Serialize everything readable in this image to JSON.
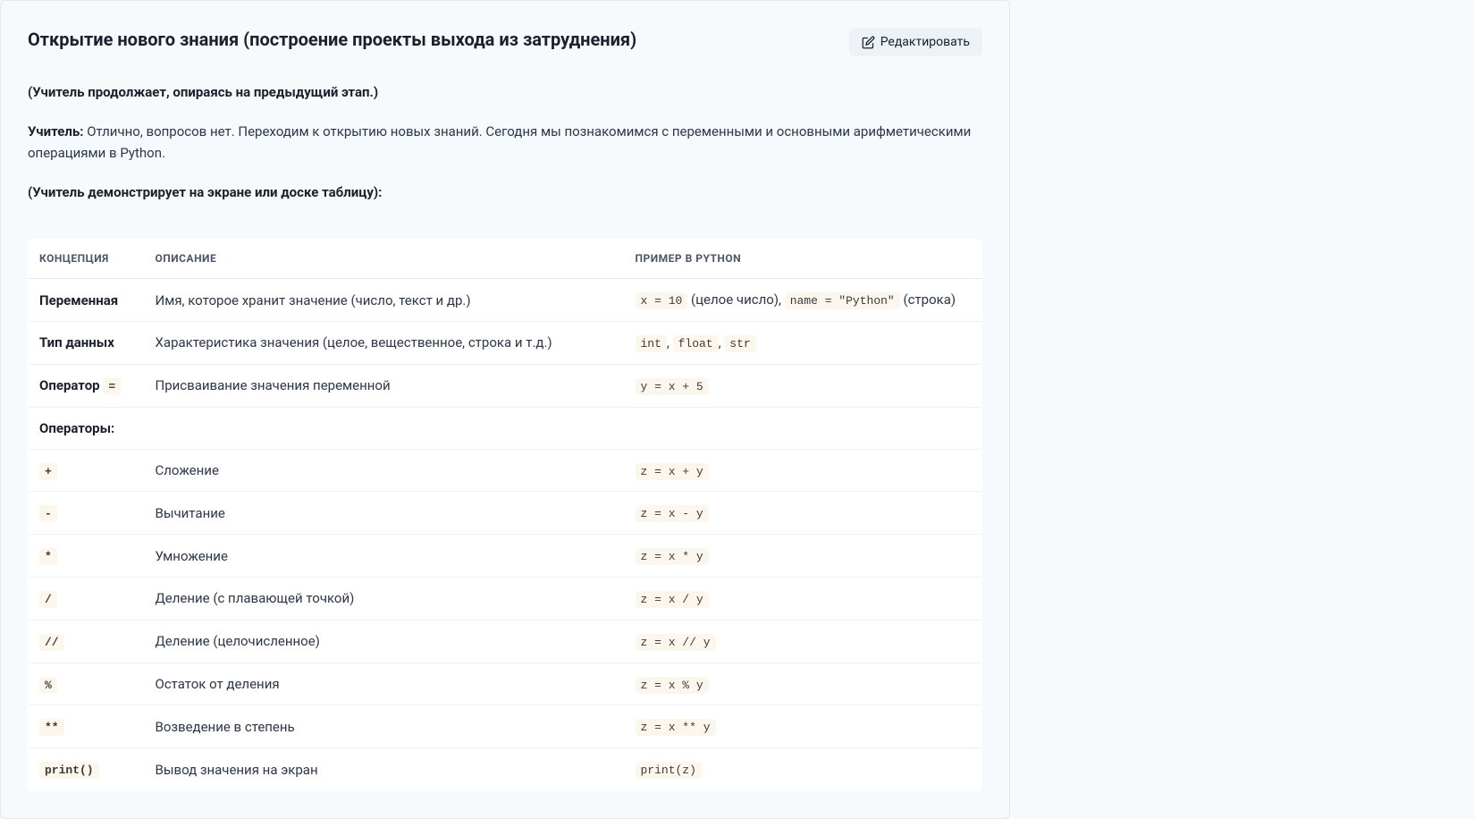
{
  "header": {
    "title": "Открытие нового знания (построение проекты выхода из затруднения)",
    "edit_label": "Редактировать"
  },
  "intro": {
    "line1": "(Учитель продолжает, опираясь на предыдущий этап.)",
    "teacher_label": "Учитель:",
    "teacher_text": " Отлично, вопросов нет. Переходим к открытию новых знаний. Сегодня мы познакомимся с переменными и основными арифметическими операциями в Python.",
    "line3": "(Учитель демонстрирует на экране или доске таблицу):"
  },
  "table": {
    "headers": {
      "concept": "Концепция",
      "description": "Описание",
      "example": "Пример в Python"
    },
    "rows": [
      {
        "concept_bold": "Переменная",
        "concept_code": "",
        "description": "Имя, которое хранит значение (число, текст и др.)",
        "example_parts": [
          {
            "type": "code",
            "v": "x = 10"
          },
          {
            "type": "text",
            "v": " (целое число), "
          },
          {
            "type": "code",
            "v": "name = \"Python\""
          },
          {
            "type": "text",
            "v": " (строка)"
          }
        ]
      },
      {
        "concept_bold": "Тип данных",
        "concept_code": "",
        "description": "Характеристика значения (целое, вещественное, строка и т.д.)",
        "example_parts": [
          {
            "type": "code",
            "v": "int"
          },
          {
            "type": "text",
            "v": ", "
          },
          {
            "type": "code",
            "v": "float"
          },
          {
            "type": "text",
            "v": ", "
          },
          {
            "type": "code",
            "v": "str"
          }
        ]
      },
      {
        "concept_bold": "Оператор ",
        "concept_code": "=",
        "description": "Присваивание значения переменной",
        "example_parts": [
          {
            "type": "code",
            "v": "y = x + 5"
          }
        ]
      },
      {
        "concept_bold": "Операторы:",
        "concept_code": "",
        "description": "",
        "example_parts": []
      },
      {
        "concept_bold": "",
        "concept_code": "+",
        "description": "Сложение",
        "example_parts": [
          {
            "type": "code",
            "v": "z = x + y"
          }
        ]
      },
      {
        "concept_bold": "",
        "concept_code": "-",
        "description": "Вычитание",
        "example_parts": [
          {
            "type": "code",
            "v": "z = x - y"
          }
        ]
      },
      {
        "concept_bold": "",
        "concept_code": "*",
        "description": "Умножение",
        "example_parts": [
          {
            "type": "code",
            "v": "z = x * y"
          }
        ]
      },
      {
        "concept_bold": "",
        "concept_code": "/",
        "description": "Деление (с плавающей точкой)",
        "example_parts": [
          {
            "type": "code",
            "v": "z = x / y"
          }
        ]
      },
      {
        "concept_bold": "",
        "concept_code": "//",
        "description": "Деление (целочисленное)",
        "example_parts": [
          {
            "type": "code",
            "v": "z = x // y"
          }
        ]
      },
      {
        "concept_bold": "",
        "concept_code": "%",
        "description": "Остаток от деления",
        "example_parts": [
          {
            "type": "code",
            "v": "z = x % y"
          }
        ]
      },
      {
        "concept_bold": "",
        "concept_code": "**",
        "description": "Возведение в степень",
        "example_parts": [
          {
            "type": "code",
            "v": "z = x ** y"
          }
        ]
      },
      {
        "concept_bold": "",
        "concept_code": "print()",
        "description": "Вывод значения на экран",
        "example_parts": [
          {
            "type": "code",
            "v": "print(z)"
          }
        ]
      }
    ]
  }
}
